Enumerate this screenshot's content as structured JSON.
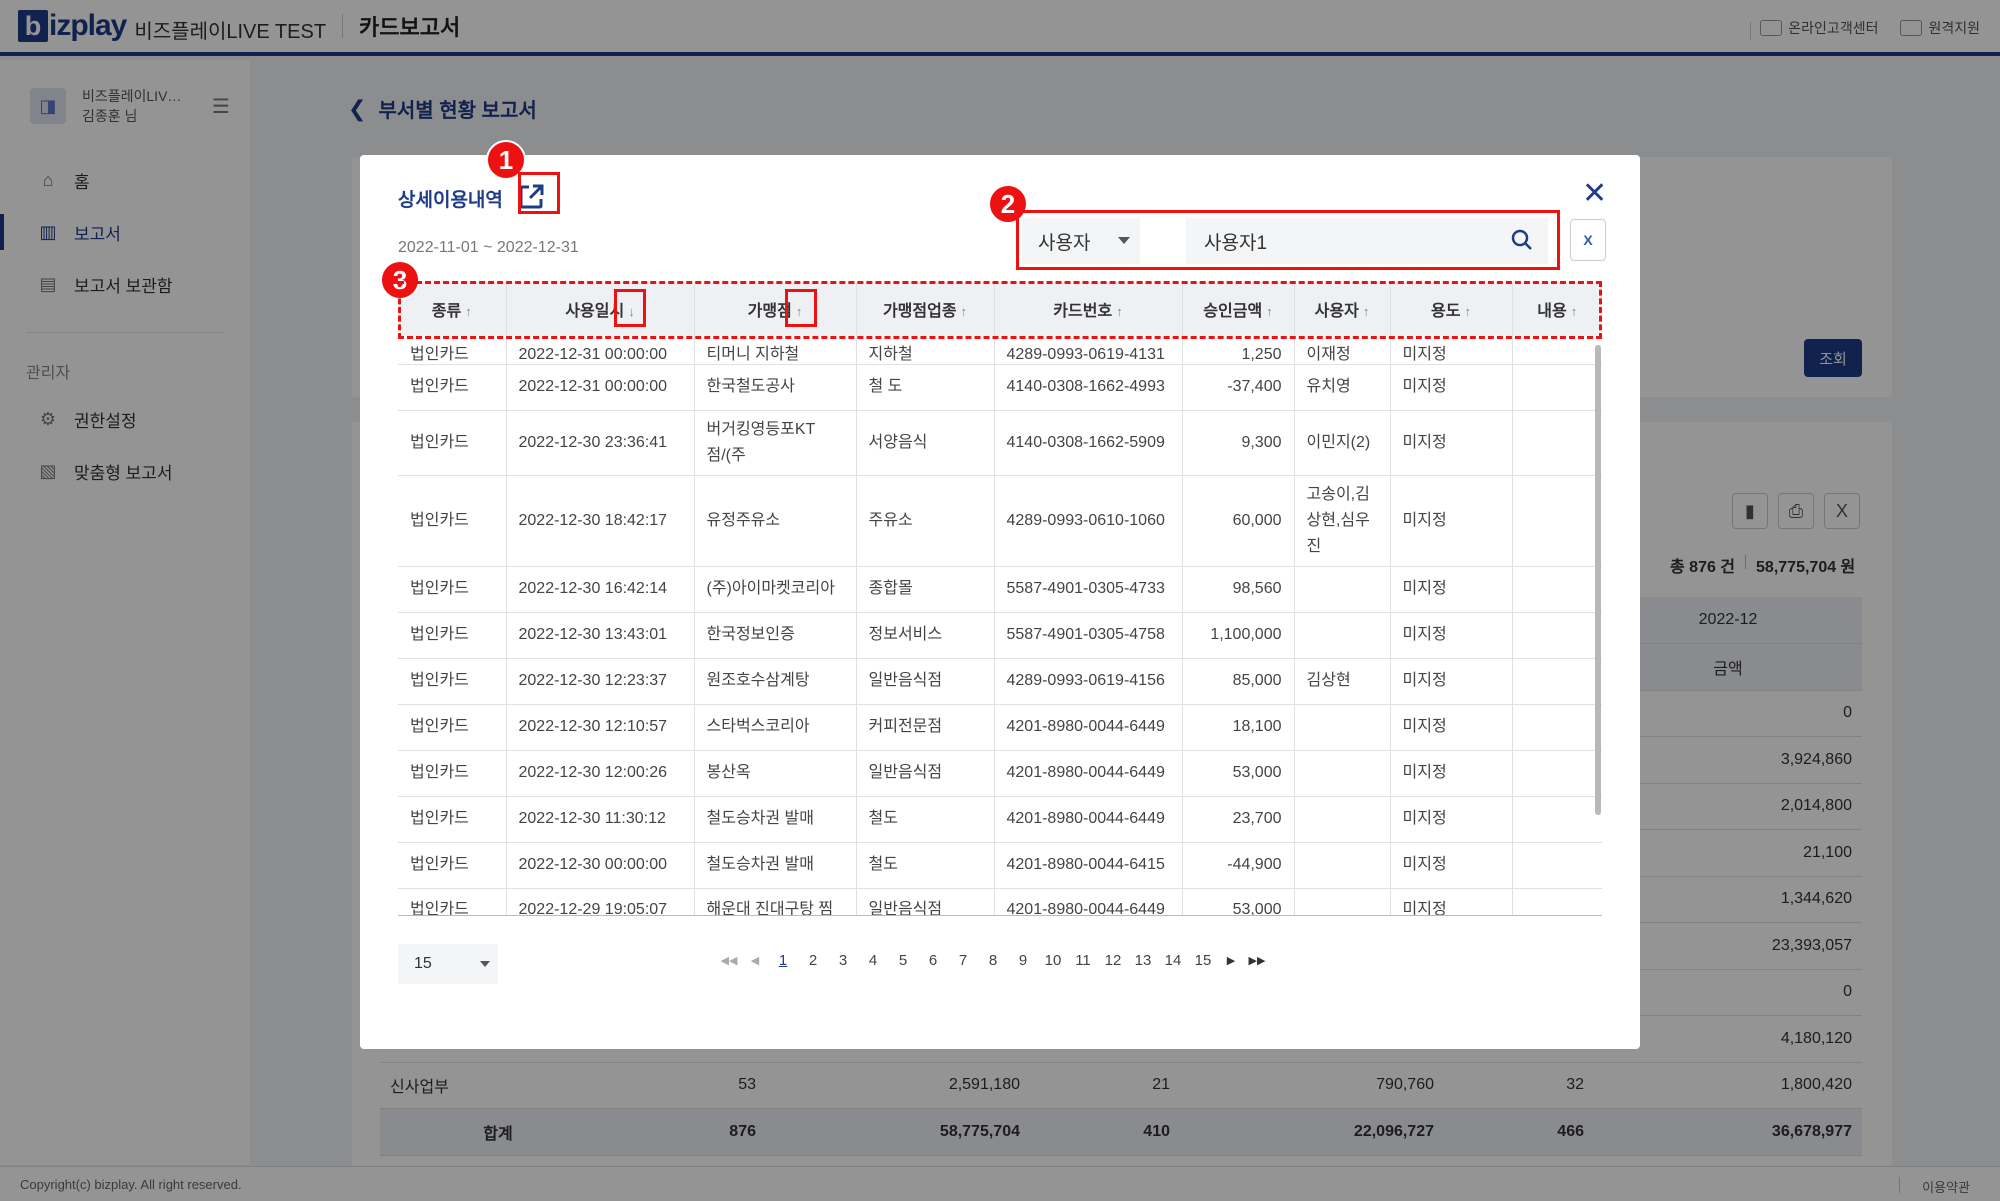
{
  "header": {
    "logo_b": "b",
    "logo_text": "izplay",
    "company": "비즈플레이LIVE TEST",
    "page_name": "카드보고서",
    "support_label": "온라인고객센터",
    "remote_label": "원격지원"
  },
  "sidebar": {
    "company_short": "비즈플레이LIV…",
    "user_name": "김종훈 님",
    "items": [
      {
        "label": "홈",
        "icon": "home-icon"
      },
      {
        "label": "보고서",
        "icon": "report-icon"
      },
      {
        "label": "보고서 보관함",
        "icon": "archive-icon"
      }
    ],
    "admin_section": "관리자",
    "admin_items": [
      {
        "label": "권한설정",
        "icon": "permission-icon"
      },
      {
        "label": "맞춤형 보고서",
        "icon": "custom-report-icon"
      }
    ]
  },
  "page": {
    "back_title": "부서별 현황 보고서",
    "search_button": "조회",
    "total_count": "총 876 건",
    "total_amount": "58,775,704 원",
    "bg_header_period": "2022-12",
    "bg_header_amount": "금액",
    "bg_amounts": [
      "0",
      "3,924,860",
      "2,014,800",
      "21,100",
      "1,344,620",
      "23,393,057",
      "0",
      "4,180,120"
    ],
    "bg_row_dept": {
      "name": "신사업부",
      "c1": "53",
      "c2": "2,591,180",
      "c3": "21",
      "c4": "790,760",
      "c5": "32",
      "c6": "1,800,420"
    },
    "bg_row_total": {
      "name": "합계",
      "c1": "876",
      "c2": "58,775,704",
      "c3": "410",
      "c4": "22,096,727",
      "c5": "466",
      "c6": "36,678,977"
    }
  },
  "modal": {
    "title": "상세이용내역",
    "date_range": "2022-11-01 ~ 2022-12-31",
    "filter_type": "사용자",
    "filter_value": "사용자1",
    "columns": [
      "종류",
      "사용일시",
      "가맹점",
      "가맹점업종",
      "카드번호",
      "승인금액",
      "사용자",
      "용도",
      "내용"
    ],
    "rows": [
      [
        "법인카드",
        "2022-12-31 00:00:00",
        "티머니 지하철",
        "지하철",
        "4289-0993-0619-4131",
        "1,250",
        "이재정",
        "미지정",
        ""
      ],
      [
        "법인카드",
        "2022-12-31 00:00:00",
        "한국철도공사",
        "철 도",
        "4140-0308-1662-4993",
        "-37,400",
        "유치영",
        "미지정",
        ""
      ],
      [
        "법인카드",
        "2022-12-30 23:36:41",
        "버거킹영등포KT점/(주",
        "서양음식",
        "4140-0308-1662-5909",
        "9,300",
        "이민지(2)",
        "미지정",
        ""
      ],
      [
        "법인카드",
        "2022-12-30 18:42:17",
        "유정주유소",
        "주유소",
        "4289-0993-0610-1060",
        "60,000",
        "고송이,김상현,심우진",
        "미지정",
        ""
      ],
      [
        "법인카드",
        "2022-12-30 16:42:14",
        "(주)아이마켓코리아",
        "종합몰",
        "5587-4901-0305-4733",
        "98,560",
        "",
        "미지정",
        ""
      ],
      [
        "법인카드",
        "2022-12-30 13:43:01",
        "한국정보인증",
        "정보서비스",
        "5587-4901-0305-4758",
        "1,100,000",
        "",
        "미지정",
        ""
      ],
      [
        "법인카드",
        "2022-12-30 12:23:37",
        "원조호수삼계탕",
        "일반음식점",
        "4289-0993-0619-4156",
        "85,000",
        "김상현",
        "미지정",
        ""
      ],
      [
        "법인카드",
        "2022-12-30 12:10:57",
        "스타벅스코리아",
        "커피전문점",
        "4201-8980-0044-6449",
        "18,100",
        "",
        "미지정",
        ""
      ],
      [
        "법인카드",
        "2022-12-30 12:00:26",
        "봉산옥",
        "일반음식점",
        "4201-8980-0044-6449",
        "53,000",
        "",
        "미지정",
        ""
      ],
      [
        "법인카드",
        "2022-12-30 11:30:12",
        "철도승차권 발매",
        "철도",
        "4201-8980-0044-6449",
        "23,700",
        "",
        "미지정",
        ""
      ],
      [
        "법인카드",
        "2022-12-30 00:00:00",
        "철도승차권 발매",
        "철도",
        "4201-8980-0044-6415",
        "-44,900",
        "",
        "미지정",
        ""
      ],
      [
        "법인카드",
        "2022-12-29 19:05:07",
        "해운대 진대구탕 찜",
        "일반음식점",
        "4201-8980-0044-6449",
        "53,000",
        "",
        "미지정",
        ""
      ]
    ],
    "page_size": "15",
    "pages": [
      "1",
      "2",
      "3",
      "4",
      "5",
      "6",
      "7",
      "8",
      "9",
      "10",
      "11",
      "12",
      "13",
      "14",
      "15"
    ],
    "current_page": "1"
  },
  "annotations": [
    "1",
    "2",
    "3"
  ],
  "footer": {
    "copyright": "Copyright(c) bizplay. All right reserved.",
    "terms": "이용약관"
  },
  "colors": {
    "brand": "#1f3c88",
    "annotation": "#ee1111"
  }
}
